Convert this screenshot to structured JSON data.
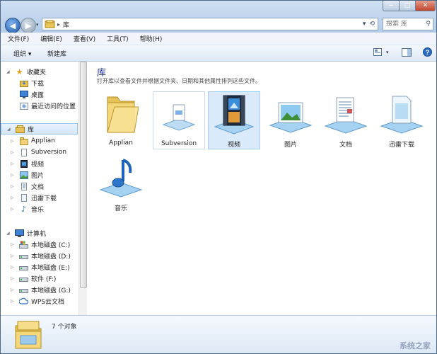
{
  "address": {
    "current": "库",
    "search_placeholder": "搜索 库"
  },
  "menu": [
    "文件(F)",
    "编辑(E)",
    "查看(V)",
    "工具(T)",
    "帮助(H)"
  ],
  "toolbar": {
    "organize": "组织 ▾",
    "new_library": "新建库"
  },
  "nav": {
    "favorites": {
      "label": "收藏夹",
      "items": [
        "下载",
        "桌面",
        "最近访问的位置"
      ]
    },
    "libraries": {
      "label": "库",
      "items": [
        "Applian",
        "Subversion",
        "视频",
        "图片",
        "文档",
        "迅雷下载",
        "音乐"
      ]
    },
    "computer": {
      "label": "计算机",
      "items": [
        "本地磁盘 (C:)",
        "本地磁盘 (D:)",
        "本地磁盘 (E:)",
        "软件 (F:)",
        "本地磁盘 (G:)",
        "WPS云文档"
      ]
    }
  },
  "content": {
    "title": "库",
    "description": "打开库以查看文件并根据文件夹、日期和其他属性排列这些文件。",
    "items": [
      "Applian",
      "Subversion",
      "视频",
      "图片",
      "文档",
      "迅雷下载",
      "音乐"
    ]
  },
  "details": {
    "count": "7 个对象"
  },
  "watermark": "系统之家",
  "colors": {
    "accent": "#1e3287",
    "selection": "#dbeafb",
    "window_frame": "#4e6887"
  }
}
